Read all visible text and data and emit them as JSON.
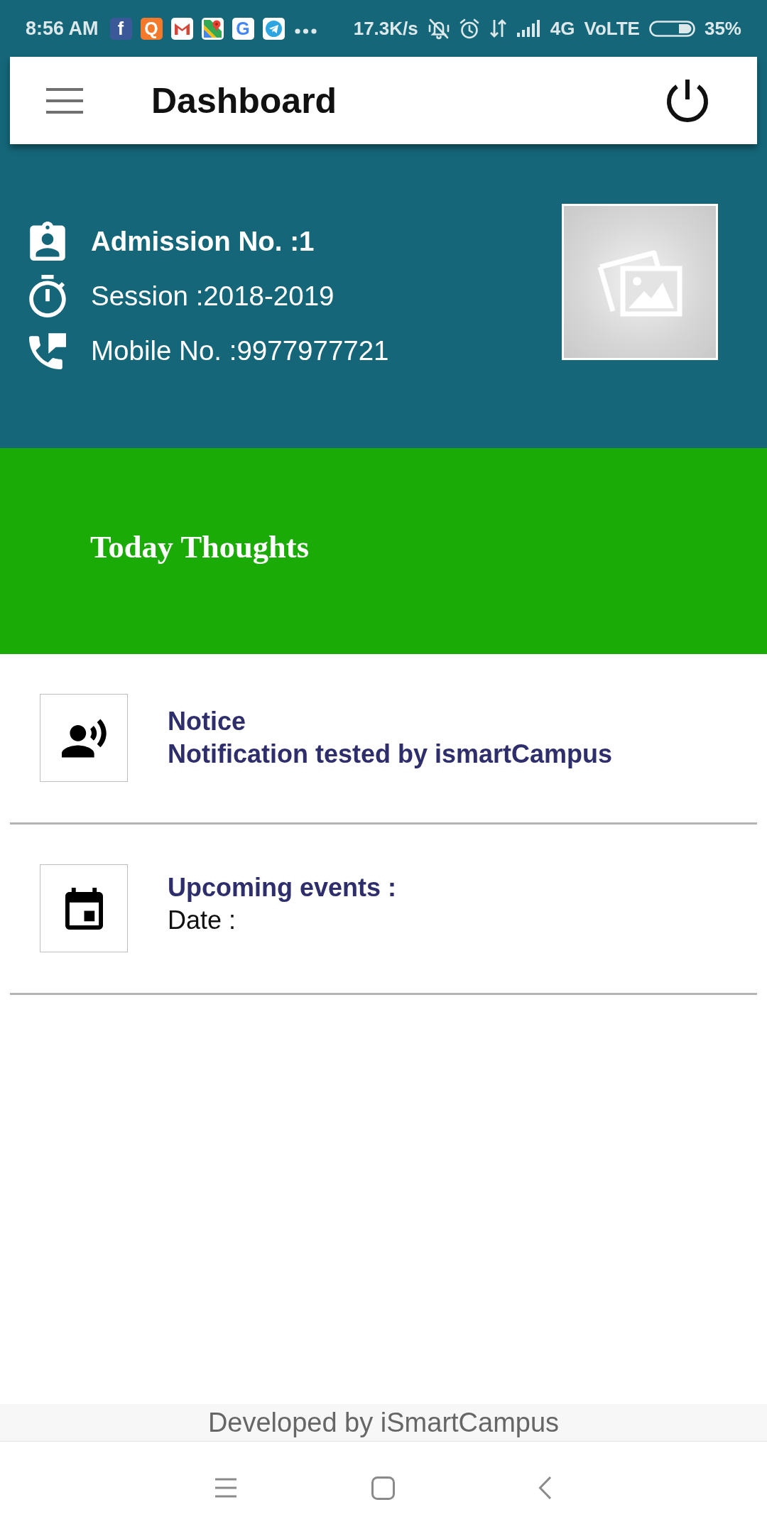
{
  "status_bar": {
    "time": "8:56 AM",
    "app_icons": [
      {
        "kind": "tile",
        "letter": "f",
        "color": "#3b5998"
      },
      {
        "kind": "tile",
        "letter": "Q",
        "color": "#f4792a"
      },
      {
        "kind": "mail"
      },
      {
        "kind": "map"
      },
      {
        "kind": "letter",
        "letter": "G",
        "color": "#4285f4"
      },
      {
        "kind": "plane"
      }
    ],
    "network_speed": "17.3K/s",
    "network_type": "4G",
    "volte": "VoLTE",
    "battery": "35%"
  },
  "app_bar": {
    "title": "Dashboard"
  },
  "profile": {
    "rows": [
      {
        "kind": "admission",
        "text": "Admission No. :1",
        "bold": true
      },
      {
        "kind": "session",
        "text": "Session :2018-2019",
        "bold": false
      },
      {
        "kind": "mobile",
        "text": "Mobile No. :9977977721",
        "bold": false
      }
    ]
  },
  "thoughts": {
    "title": "Today Thoughts"
  },
  "feed": [
    {
      "kind": "notice",
      "title": "Notice",
      "text": "Notification tested by ismartCampus"
    },
    {
      "kind": "event",
      "title": "Upcoming events :",
      "text": "Date :"
    }
  ],
  "footer": {
    "credit": "Developed by iSmartCampus"
  }
}
